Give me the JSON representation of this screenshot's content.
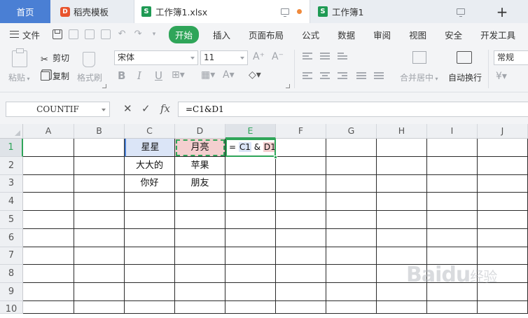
{
  "tabs": [
    {
      "label": "首页"
    },
    {
      "label": "稻壳模板"
    },
    {
      "label": "工作簿1.xlsx"
    },
    {
      "label": "工作簿1"
    }
  ],
  "menu": {
    "file": "文件",
    "tabs": [
      "开始",
      "插入",
      "页面布局",
      "公式",
      "数据",
      "审阅",
      "视图",
      "安全",
      "开发工具"
    ]
  },
  "ribbon": {
    "paste": "粘贴",
    "cut": "剪切",
    "copy": "复制",
    "format_painter": "格式刷",
    "font_name": "宋体",
    "font_size": "11",
    "merge_center": "合并居中",
    "wrap_text": "自动换行",
    "number_format": "常规"
  },
  "formula_bar": {
    "name_box": "COUNTIF",
    "fx": "fx",
    "formula": "=C1&D1"
  },
  "grid": {
    "columns": [
      "A",
      "B",
      "C",
      "D",
      "E",
      "F",
      "G",
      "H",
      "I",
      "J"
    ],
    "rows": [
      "1",
      "2",
      "3",
      "4",
      "5",
      "6",
      "7",
      "8",
      "9",
      "10"
    ],
    "cells": {
      "C1": "星星",
      "D1": "月亮",
      "C2": "大大的",
      "D2": "苹果",
      "C3": "你好",
      "D3": "朋友"
    },
    "edit_cell": {
      "eq": "=",
      "ref1": "C1",
      "amp": "&",
      "ref2": "D1"
    }
  },
  "watermark": {
    "main": "Baidu",
    "sub": "经验"
  },
  "colors": {
    "accent": "#2fa559",
    "home_tab": "#4a7fd4",
    "ref1_fill": "#dbe5f7",
    "ref2_fill": "#f4cfcf"
  }
}
